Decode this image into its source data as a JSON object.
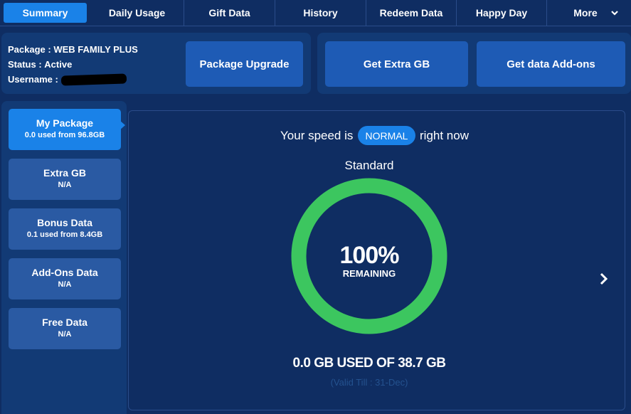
{
  "nav": {
    "tabs": [
      {
        "label": "Summary",
        "active": true
      },
      {
        "label": "Daily Usage"
      },
      {
        "label": "Gift Data"
      },
      {
        "label": "History"
      },
      {
        "label": "Redeem Data"
      },
      {
        "label": "Happy Day"
      },
      {
        "label": "More",
        "icon": "chevron-down-icon"
      }
    ]
  },
  "account": {
    "package_label": "Package :",
    "package_value": "WEB FAMILY PLUS",
    "status_label": "Status :",
    "status_value": "Active",
    "username_label": "Username :"
  },
  "actions": {
    "package_upgrade": "Package Upgrade",
    "extra_gb": "Get Extra GB",
    "data_addons": "Get data Add-ons"
  },
  "side_menu": [
    {
      "label": "My Package",
      "sub": "0.0 used from 96.8GB",
      "active": true
    },
    {
      "label": "Extra GB",
      "sub": "N/A"
    },
    {
      "label": "Bonus Data",
      "sub": "0.1 used from 8.4GB"
    },
    {
      "label": "Add-Ons Data",
      "sub": "N/A"
    },
    {
      "label": "Free Data",
      "sub": "N/A"
    }
  ],
  "main": {
    "speed_prefix": "Your speed is",
    "speed_status": "NORMAL",
    "speed_suffix": "right now",
    "plan_name": "Standard",
    "remaining_percent": "100%",
    "remaining_label": "REMAINING",
    "remaining_fraction": 1.0,
    "usage_text": "0.0 GB USED OF 38.7 GB",
    "valid_text": "(Valid Till : 31-Dec)"
  },
  "colors": {
    "background": "#0f2d62",
    "panel": "#123a75",
    "accent": "#1a82e8",
    "button": "#1e5bb5",
    "ring": "#3cc65f",
    "muted_text": "#24528f"
  }
}
